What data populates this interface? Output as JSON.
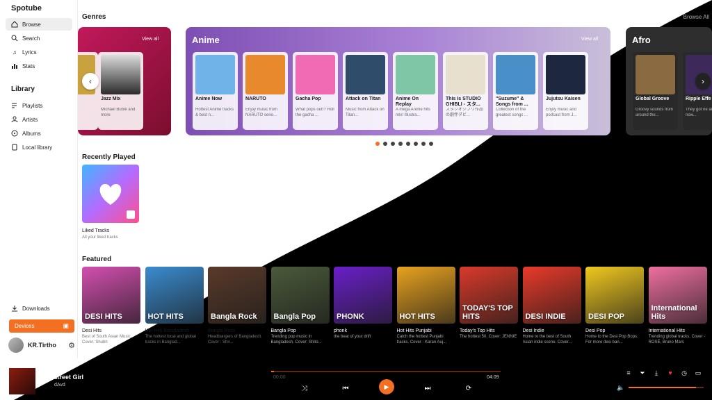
{
  "app": {
    "title": "Spotube"
  },
  "sidebar": {
    "nav": [
      "Browse",
      "Search",
      "Lyrics",
      "Stats"
    ],
    "library_title": "Library",
    "library": [
      "Playlists",
      "Artists",
      "Albums",
      "Local library"
    ],
    "downloads": "Downloads",
    "devices": "Devices",
    "username": "KR.Tirtho"
  },
  "genres": {
    "title": "Genres",
    "browse_all": "Browse All",
    "view_all": "View all",
    "prev_card": {
      "items": [
        {
          "title": "",
          "desc": "and",
          "color": "#c9a23f"
        },
        {
          "title": "Jazz Mix",
          "desc": "Michael Bublé and more",
          "color": "#2b2b2b"
        }
      ]
    },
    "anime": {
      "name": "Anime",
      "items": [
        {
          "title": "Anime Now",
          "desc": "Hottest Anime tracks & best n...",
          "color": "#6fb3e8"
        },
        {
          "title": "NARUTO",
          "desc": "Enjoy music from NARUTO serie...",
          "color": "#e8892e"
        },
        {
          "title": "Gacha Pop",
          "desc": "What pops out!? Roll the gacha ...",
          "color": "#f06bb3"
        },
        {
          "title": "Attack on Titan",
          "desc": "Music from Attack on Titan...",
          "color": "#2f4d6b"
        },
        {
          "title": "Anime On Replay",
          "desc": "A mega Anime hits mix! Illustra...",
          "color": "#7fc6a4"
        },
        {
          "title": "This Is STUDIO GHIBLI - スタ...",
          "desc": "スタジオジブリ作品の劇伴ダビ...",
          "color": "#e8e0cf"
        },
        {
          "title": "\"Suzume\" & Songs from ...",
          "desc": "Collection of the greatest songs ...",
          "color": "#4a90c8"
        },
        {
          "title": "Jujutsu Kaisen",
          "desc": "Enjoy music and podcast from J...",
          "color": "#1d2740"
        }
      ]
    },
    "afro": {
      "name": "Afro",
      "items": [
        {
          "title": "Global Groove",
          "desc": "Groovy sounds from around the...",
          "color": "#8a6a40"
        },
        {
          "title": "Ripple Effe",
          "desc": "They got ne and now...",
          "color": "#3d2a5a"
        }
      ]
    }
  },
  "recent": {
    "title": "Recently Played",
    "liked_title": "Liked Tracks",
    "liked_sub": "All your liked tracks"
  },
  "featured": {
    "title": "Featured",
    "items": [
      {
        "title": "Desi Hits",
        "desc": "Best of South Asian Music. Cover: Shubh",
        "label": "DESI HITS",
        "color": "#d44fb0"
      },
      {
        "title": "Hot Hits Bangladesh",
        "desc": "The hottest local and global tracks in Banglad...",
        "label": "HOT HITS",
        "color": "#3a8cd0"
      },
      {
        "title": "Bangla Rock",
        "desc": "Headbangers of Bangladesh. Cover : Shir...",
        "label": "Bangla Rock",
        "color": "#5a3a2a"
      },
      {
        "title": "Bangla Pop",
        "desc": "Trending pop music in Bangladesh. Cover: Shito...",
        "label": "Bangla Pop",
        "color": "#4a5a3a"
      },
      {
        "title": "phonk",
        "desc": "the beat of your drift",
        "label": "PHONK",
        "color": "#6a1fc8"
      },
      {
        "title": "Hot Hits Punjabi",
        "desc": "Catch the hottest Punjabi tracks. Cover - Karan Auj...",
        "label": "HOT HITS",
        "color": "#e8a21f"
      },
      {
        "title": "Today's Top Hits",
        "desc": "The hottest 50. Cover: JENNIE",
        "label": "TODAY'S TOP HITS",
        "color": "#d93a2a"
      },
      {
        "title": "Desi Indie",
        "desc": "Home to the best of South Asian indie scene. Cover...",
        "label": "DESI INDIE",
        "color": "#e83a2a"
      },
      {
        "title": "Desi Pop",
        "desc": "Home to the Desi Pop Bops. For more desi ban...",
        "label": "DESI POP",
        "color": "#f0c81f"
      },
      {
        "title": "International Hits",
        "desc": "Trending global tracks. Cover - ROSÉ, Bruno Mars",
        "label": "International Hits",
        "color": "#ee6fa0"
      }
    ]
  },
  "player": {
    "title": "Backstreet Girl",
    "artist": "dAvd",
    "time_current": "00:00",
    "time_total": "04:09",
    "progress": 0.01,
    "volume": 0.9
  },
  "colors": {
    "accent": "#f37022",
    "dark": "#000000"
  }
}
